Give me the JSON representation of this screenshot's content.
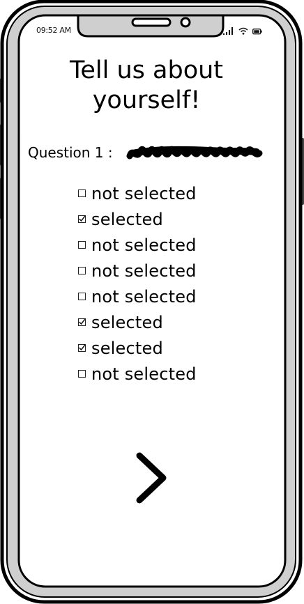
{
  "status_bar": {
    "time": "09:52 AM",
    "icons": [
      "signal-icon",
      "wifi-icon",
      "battery-icon"
    ]
  },
  "page": {
    "title": "Tell us about yourself!"
  },
  "question": {
    "label": "Question 1 :",
    "text_placeholder": "scribbled-text"
  },
  "answers": [
    {
      "label": "not selected",
      "checked": false
    },
    {
      "label": "selected",
      "checked": true
    },
    {
      "label": "not selected",
      "checked": false
    },
    {
      "label": "not selected",
      "checked": false
    },
    {
      "label": "not selected",
      "checked": false
    },
    {
      "label": "selected",
      "checked": true
    },
    {
      "label": "selected",
      "checked": true
    },
    {
      "label": "not selected",
      "checked": false
    }
  ],
  "navigation": {
    "next_icon": "chevron-right-icon"
  }
}
